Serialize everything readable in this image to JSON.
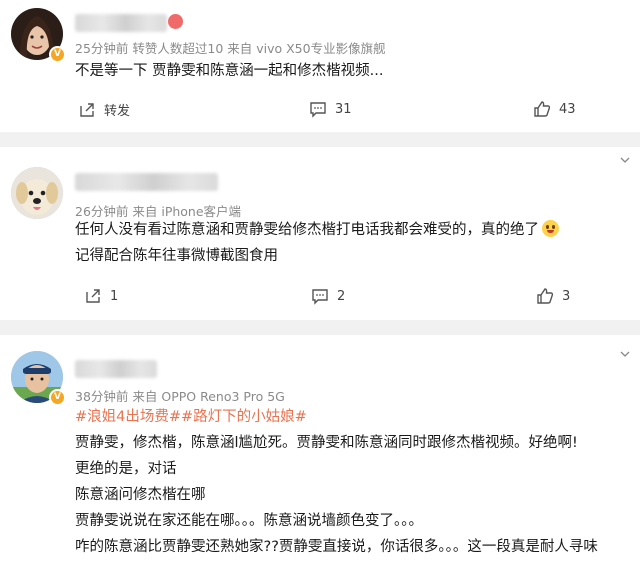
{
  "comments": [
    {
      "meta": "25分钟前 转赞人数超过10 来自 vivo X50专业影像旗舰",
      "lines": [
        "不是等一下 贾静雯和陈意涵一起和修杰楷视频..."
      ],
      "repost_label": "转发",
      "comment_count": "31",
      "like_count": "43",
      "avatar_icon": "woman-portrait-icon",
      "badge_color": "#f5a623"
    },
    {
      "meta": "26分钟前 来自 iPhone客户端",
      "lines": [
        "任何人没有看过陈意涵和贾静雯给修杰楷打电话我都会难受的，真的绝了",
        "记得配合陈年往事微博截图食用"
      ],
      "repost_count": "1",
      "comment_count": "2",
      "like_count": "3",
      "avatar_icon": "dog-portrait-icon"
    },
    {
      "meta": "38分钟前 来自 OPPO Reno3 Pro 5G",
      "topic": "#浪姐4出场费##路灯下的小姑娘#",
      "lines": [
        "贾静雯，修杰楷，陈意涵l尴尬死。贾静雯和陈意涵同时跟修杰楷视频。好绝啊!",
        "更绝的是，对话",
        "陈意涵问修杰楷在哪",
        "贾静雯说说在家还能在哪。。。陈意涵说墙颜色变了。。。",
        "咋的陈意涵比贾静雯还熟她家??贾静雯直接说，你话很多。。。这一段真是耐人寻味"
      ],
      "avatar_icon": "man-portrait-icon"
    }
  ],
  "accent_color": "#eb7350"
}
